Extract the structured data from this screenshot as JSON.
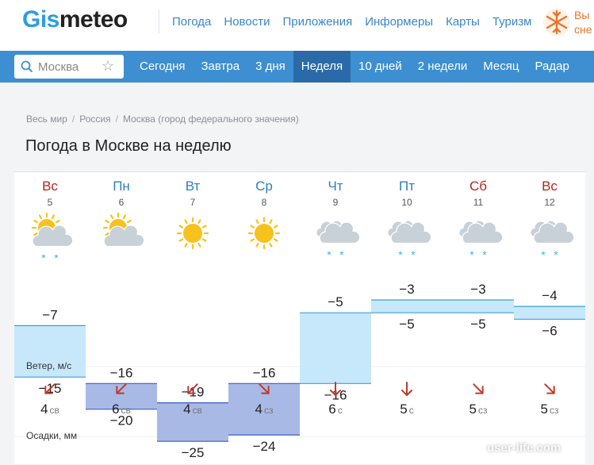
{
  "logo": {
    "part1": "Gis",
    "part2": "meteo"
  },
  "top_nav": [
    "Погода",
    "Новости",
    "Приложения",
    "Информеры",
    "Карты",
    "Туризм"
  ],
  "promo": {
    "line1": "Вы",
    "line2": "сне"
  },
  "search": {
    "placeholder": "Москва"
  },
  "day_tabs": [
    "Сегодня",
    "Завтра",
    "3 дня",
    "Неделя",
    "10 дней",
    "2 недели",
    "Месяц",
    "Радар"
  ],
  "active_tab": "Неделя",
  "breadcrumbs": [
    "Весь мир",
    "Россия",
    "Москва (город федерального значения)"
  ],
  "page_title": "Погода в Москве на неделю",
  "days": [
    {
      "name": "Вс",
      "date": "5",
      "weekend": true,
      "icon": "partly-cloudy-snow-icon",
      "tmax": "−7",
      "tmin": "−15",
      "wind_speed": "4",
      "wind_dir": "св",
      "wind_arrow": "sw"
    },
    {
      "name": "Пн",
      "date": "6",
      "weekend": false,
      "icon": "partly-cloudy-icon",
      "tmax": "−16",
      "tmin": "−20",
      "wind_speed": "6",
      "wind_dir": "св",
      "wind_arrow": "sw"
    },
    {
      "name": "Вт",
      "date": "7",
      "weekend": false,
      "icon": "sun-icon",
      "tmax": "−19",
      "tmin": "−25",
      "wind_speed": "4",
      "wind_dir": "св",
      "wind_arrow": "sw"
    },
    {
      "name": "Ср",
      "date": "8",
      "weekend": false,
      "icon": "sun-icon",
      "tmax": "−16",
      "tmin": "−24",
      "wind_speed": "4",
      "wind_dir": "сз",
      "wind_arrow": "se"
    },
    {
      "name": "Чт",
      "date": "9",
      "weekend": false,
      "icon": "cloud-snow-icon",
      "tmax": "−5",
      "tmin": "−16",
      "wind_speed": "6",
      "wind_dir": "с",
      "wind_arrow": "s"
    },
    {
      "name": "Пт",
      "date": "10",
      "weekend": false,
      "icon": "cloud-snow-icon",
      "tmax": "−3",
      "tmin": "−5",
      "wind_speed": "5",
      "wind_dir": "с",
      "wind_arrow": "s"
    },
    {
      "name": "Сб",
      "date": "11",
      "weekend": true,
      "icon": "cloud-snow-icon",
      "tmax": "−3",
      "tmin": "−5",
      "wind_speed": "5",
      "wind_dir": "сз",
      "wind_arrow": "se"
    },
    {
      "name": "Вс",
      "date": "12",
      "weekend": true,
      "icon": "cloud-snow-icon",
      "tmax": "−4",
      "tmin": "−6",
      "wind_speed": "5",
      "wind_dir": "сз",
      "wind_arrow": "se"
    }
  ],
  "wind_label": "Ветер, м/с",
  "precip_label": "Осадки, мм",
  "watermark": "user-life.com",
  "colors": {
    "brand_blue": "#3d8fd1",
    "active_tab": "#2a6aa8",
    "link": "#3a86c8",
    "weekend_red": "#b3261e",
    "weekday_blue": "#2f7fc4",
    "sun": "#f7c21b",
    "cloud": "#c8d0d8",
    "snow_dot": "#3fb3e6",
    "warm_fill": "#c7e8fa",
    "cold_fill": "#a9b9e6",
    "warm_line": "#3aa0d8",
    "cold_line": "#3a5fc8",
    "wind_arrow": "#c0392b",
    "promo_orange": "#e8752a"
  }
}
